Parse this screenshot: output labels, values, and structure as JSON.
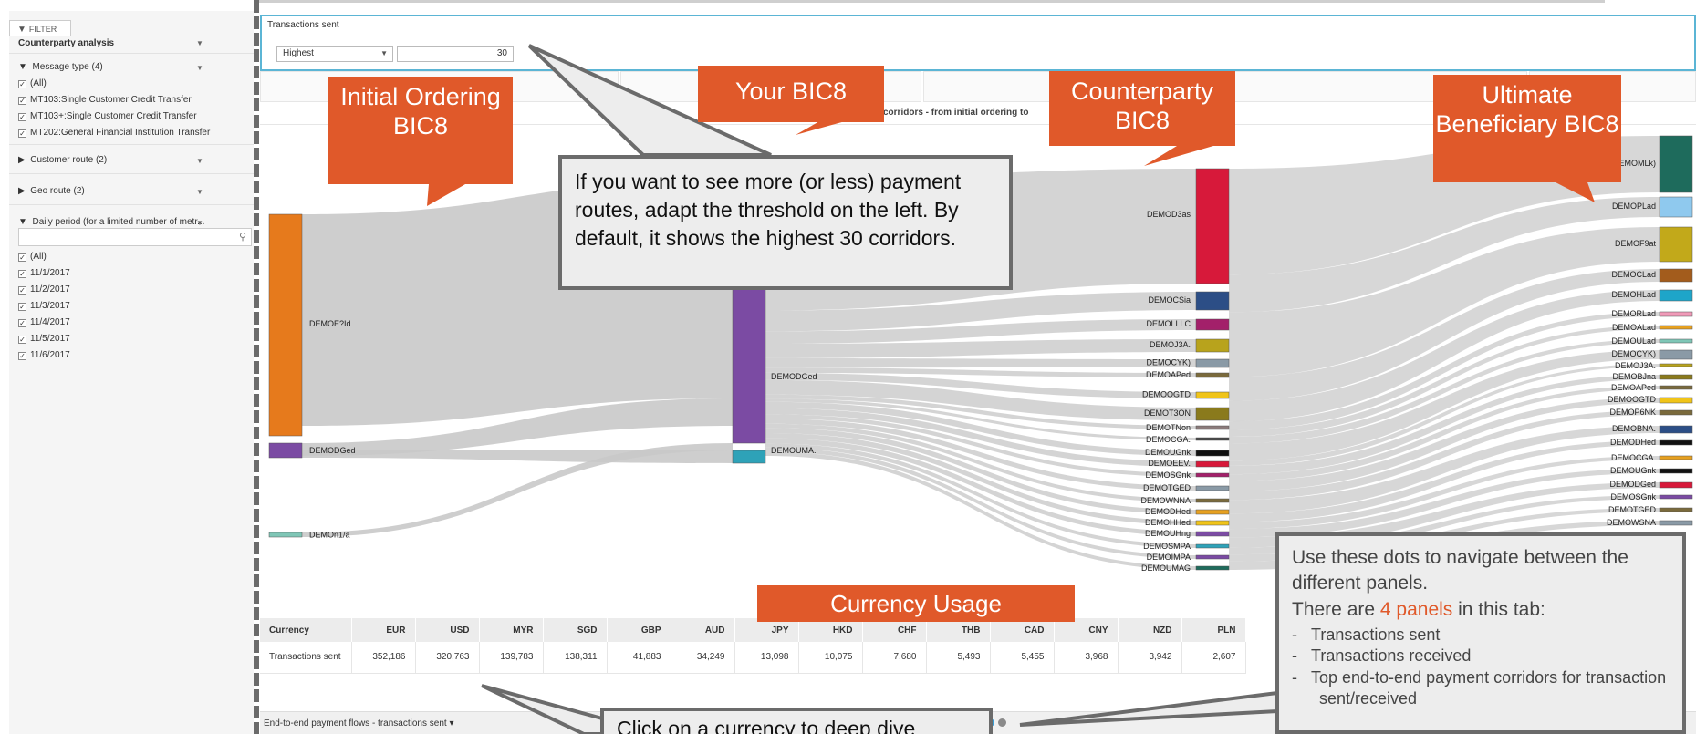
{
  "sidebar": {
    "tab_label": "FILTER",
    "section_title": "Counterparty analysis",
    "message_type": {
      "title": "Message type (4)",
      "options": [
        {
          "label": "(All)",
          "checked": true
        },
        {
          "label": "MT103:Single Customer Credit Transfer",
          "checked": true
        },
        {
          "label": "MT103+:Single Customer Credit Transfer",
          "checked": true
        },
        {
          "label": "MT202:General Financial Institution Transfer",
          "checked": true
        }
      ]
    },
    "customer_route": "Customer route (2)",
    "geo_route": "Geo route (2)",
    "daily_period": {
      "title": "Daily period (for a limited number of metr...",
      "options": [
        {
          "label": "(All)",
          "checked": true
        },
        {
          "label": "11/1/2017",
          "checked": true
        },
        {
          "label": "11/2/2017",
          "checked": true
        },
        {
          "label": "11/3/2017",
          "checked": true
        },
        {
          "label": "11/4/2017",
          "checked": true
        },
        {
          "label": "11/5/2017",
          "checked": true
        },
        {
          "label": "11/6/2017",
          "checked": true
        }
      ]
    }
  },
  "transactions": {
    "title": "Transactions sent",
    "select_value": "Highest",
    "threshold_value": "30"
  },
  "chart": {
    "subtitle": "corridors - from initial ordering to",
    "colors": {
      "flow": "#c9c9c9",
      "orange": "#e67a1c",
      "purple": "#7b4ba3",
      "teal": "#2ea2b8",
      "red": "#d7193a",
      "navy": "#2c4e86",
      "magenta": "#a3206a",
      "olive": "#b8a31c",
      "darkgreen": "#1e6b5c",
      "lightblue": "#8fc9ee",
      "mustard": "#c2a91a",
      "brown": "#a35c1c",
      "cyan": "#1ea5c9"
    },
    "nodes": {
      "initial": [
        {
          "label": "DEMOE?Id",
          "color": "#e67a1c"
        },
        {
          "label": "DEMODGed",
          "color": "#7b4ba3"
        },
        {
          "label": "DEMOn1/a",
          "color": "#7fc6b6"
        }
      ],
      "your": [
        {
          "label": "DEMODGed",
          "color": "#7b4ba3"
        },
        {
          "label": "DEMOUMA.",
          "color": "#2ea2b8"
        }
      ],
      "counterparty": [
        {
          "label": "DEMOD3as",
          "color": "#d7193a"
        },
        {
          "label": "DEMOCSia",
          "color": "#2c4e86"
        },
        {
          "label": "DEMOLLLC",
          "color": "#a3206a"
        },
        {
          "label": "DEMOJ3A.",
          "color": "#b8a31c"
        },
        {
          "label": "DEMOCYK)",
          "color": "#8a9aa6"
        },
        {
          "label": "DEMOAPed",
          "color": "#7a6a3c"
        },
        {
          "label": "DEMOOGTD",
          "color": "#f0c419"
        },
        {
          "label": "DEMOT3ON",
          "color": "#8a7a1c"
        },
        {
          "label": "DEMOTNon",
          "color": "#8a7a7a"
        },
        {
          "label": "DEMOCGA.",
          "color": "#444444"
        },
        {
          "label": "DEMOUGnk",
          "color": "#111111"
        },
        {
          "label": "DEMOEEV.",
          "color": "#d7193a"
        },
        {
          "label": "DEMOSGnk",
          "color": "#a3206a"
        },
        {
          "label": "DEMOTGED",
          "color": "#8a9aa6"
        },
        {
          "label": "DEMOWNNA",
          "color": "#7a6a3c"
        },
        {
          "label": "DEMODHed",
          "color": "#e6a020"
        },
        {
          "label": "DEMOHHed",
          "color": "#f0c419"
        },
        {
          "label": "DEMOUHng",
          "color": "#7b4ba3"
        },
        {
          "label": "DEMOSMPA",
          "color": "#2ea2b8"
        },
        {
          "label": "DEMOIMPA",
          "color": "#7b4ba3"
        },
        {
          "label": "DEMOUMAG",
          "color": "#1e6b5c"
        }
      ],
      "ultimate": [
        {
          "label": "DEMOMLk)",
          "color": "#1e6b5c"
        },
        {
          "label": "DEMOPLad",
          "color": "#8fc9ee"
        },
        {
          "label": "DEMOF9at",
          "color": "#c2a91a"
        },
        {
          "label": "DEMOCLad",
          "color": "#a35c1c"
        },
        {
          "label": "DEMOHLad",
          "color": "#1ea5c9"
        },
        {
          "label": "DEMORLad",
          "color": "#f09ab8"
        },
        {
          "label": "DEMOALad",
          "color": "#e6a020"
        },
        {
          "label": "DEMOULad",
          "color": "#7fc6b6"
        },
        {
          "label": "DEMOCYK)",
          "color": "#8a9aa6"
        },
        {
          "label": "DEMOJ3A.",
          "color": "#b8a31c"
        },
        {
          "label": "DEMOBJna",
          "color": "#8a7a1c"
        },
        {
          "label": "DEMOAPed",
          "color": "#7a6a3c"
        },
        {
          "label": "DEMOOGTD",
          "color": "#f0c419"
        },
        {
          "label": "DEMOP6NK",
          "color": "#7a6a3c"
        },
        {
          "label": "DEMOBNA.",
          "color": "#2c4e86"
        },
        {
          "label": "DEMODHed",
          "color": "#111111"
        },
        {
          "label": "DEMOCGA.",
          "color": "#e6a020"
        },
        {
          "label": "DEMOUGnk",
          "color": "#111111"
        },
        {
          "label": "DEMODGed",
          "color": "#d7193a"
        },
        {
          "label": "DEMOSGnk",
          "color": "#7b4ba3"
        },
        {
          "label": "DEMOTGED",
          "color": "#7a6a3c"
        },
        {
          "label": "DEMOWSNA",
          "color": "#8a9aa6"
        }
      ]
    }
  },
  "currency_table": {
    "headers": [
      "Currency",
      "EUR",
      "USD",
      "MYR",
      "SGD",
      "GBP",
      "AUD",
      "JPY",
      "HKD",
      "CHF",
      "THB",
      "CAD",
      "CNY",
      "NZD",
      "PLN"
    ],
    "row_label": "Transactions sent",
    "values": [
      "352,186",
      "320,763",
      "139,783",
      "138,311",
      "41,883",
      "34,249",
      "13,098",
      "10,075",
      "7,680",
      "5,493",
      "5,455",
      "3,968",
      "3,942",
      "2,607"
    ]
  },
  "footer": {
    "label": "End-to-end payment flows - transactions sent"
  },
  "callouts": {
    "initial": "Initial Ordering BIC8",
    "your": "Your BIC8",
    "counterparty": "Counterparty BIC8",
    "ultimate": "Ultimate Beneficiary BIC8",
    "currency_usage": "Currency Usage",
    "threshold_tip": "If you want to see more (or less) payment routes, adapt the threshold on the left. By default, it shows the highest 30 corridors.",
    "dots_tip_line1": "Use these dots to navigate between the different panels.",
    "dots_tip_line2_pre": "There are ",
    "dots_tip_highlight": "4 panels",
    "dots_tip_line2_post": " in this tab:",
    "dots_tip_items": [
      "Transactions sent",
      "Transactions received",
      "Top end-to-end payment corridors for transaction sent/received"
    ],
    "currency_tip": "Click on a currency to deep dive"
  }
}
